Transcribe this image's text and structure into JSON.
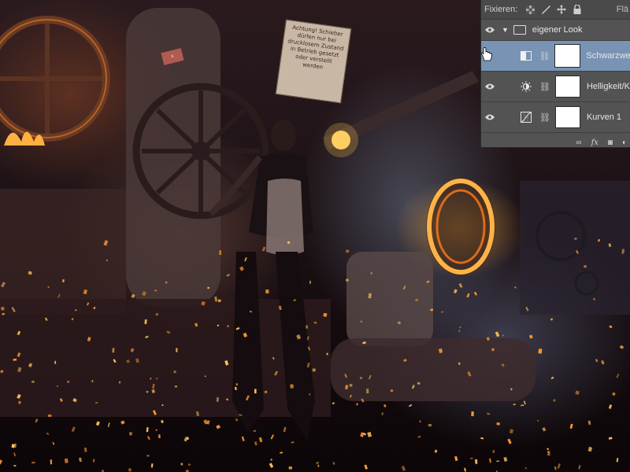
{
  "panel": {
    "lock_label": "Fixieren:",
    "fill_label": "Flä",
    "layers": [
      {
        "type": "group",
        "name": "eigener Look"
      },
      {
        "type": "adjustment",
        "name": "Schwarzwe",
        "icon": "black-white-adjustment-icon",
        "selected": true
      },
      {
        "type": "adjustment",
        "name": "Helligkeit/K",
        "icon": "brightness-contrast-icon",
        "selected": false
      },
      {
        "type": "adjustment",
        "name": "Kurven 1",
        "icon": "curves-icon",
        "selected": false
      }
    ],
    "bottom_icons": [
      "link-icon",
      "fx-icon",
      "mask-icon",
      "adjustment-icon"
    ]
  },
  "photo": {
    "sign_text": "Achtung! Schieber dürfen nur bei drucklosem Zustand in Betrieb gesetzt oder verstellt werden",
    "small_sign_text": "II"
  },
  "colors": {
    "panel_bg": "#535353",
    "selected_row": "#7993b4",
    "fire": "#ff9a2e"
  }
}
